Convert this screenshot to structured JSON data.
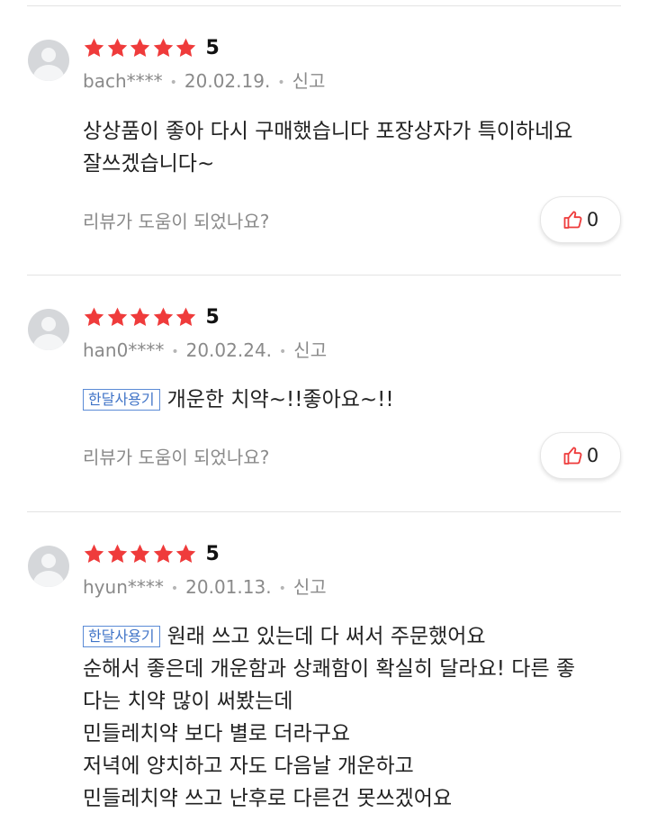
{
  "colors": {
    "star": "#ef3b3b",
    "tag_border": "#5b8bd6",
    "tag_text": "#3f73c7",
    "like_icon": "#ee3b3b",
    "muted_text": "#8a8a8a"
  },
  "helpful_prompt": "리뷰가 도움이 되었나요?",
  "reviews": [
    {
      "rating": 5,
      "rating_label": "5",
      "username": "bach****",
      "date": "20.02.19.",
      "report_label": "신고",
      "tag": "",
      "lines": [
        "상상품이 좋아 다시 구매했습니다 포장상자가 특이하네요",
        "잘쓰겠습니다~"
      ],
      "helpful_prompt": "리뷰가 도움이 되었나요?",
      "like_count": "0",
      "like_icon": "thumbs-up-icon"
    },
    {
      "rating": 5,
      "rating_label": "5",
      "username": "han0****",
      "date": "20.02.24.",
      "report_label": "신고",
      "tag": "한달사용기",
      "lines": [
        "개운한 치약~!!좋아요~!!"
      ],
      "helpful_prompt": "리뷰가 도움이 되었나요?",
      "like_count": "0",
      "like_icon": "thumbs-up-icon"
    },
    {
      "rating": 5,
      "rating_label": "5",
      "username": "hyun****",
      "date": "20.01.13.",
      "report_label": "신고",
      "tag": "한달사용기",
      "lines": [
        "원래 쓰고 있는데 다 써서 주문했어요",
        "순해서 좋은데 개운함과 상쾌함이 확실히 달라요! 다른 좋",
        "다는 치약 많이 써봤는데",
        "민들레치약 보다 별로 더라구요",
        "저녁에 양치하고 자도 다음날 개운하고",
        "민들레치약 쓰고  난후로 다른건 못쓰겠어요"
      ]
    }
  ]
}
